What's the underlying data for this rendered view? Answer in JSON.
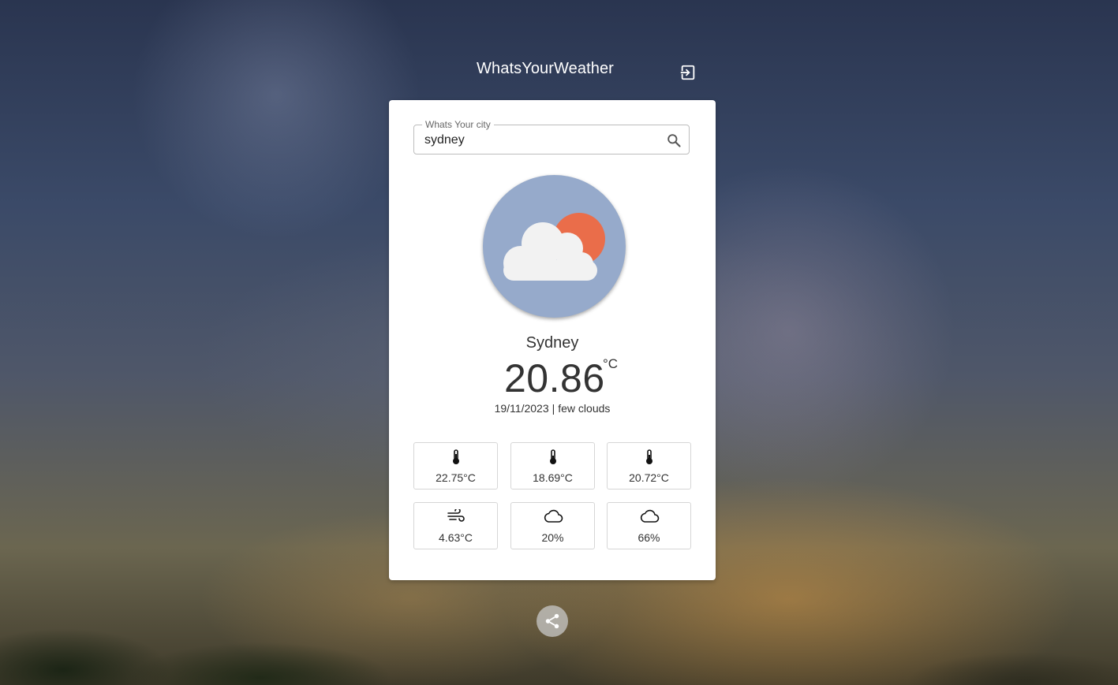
{
  "app": {
    "title": "WhatsYourWeather"
  },
  "search": {
    "label": "Whats Your city",
    "value": "sydney",
    "placeholder": "Whats Your city"
  },
  "weather": {
    "icon": "few-clouds-icon",
    "city": "Sydney",
    "temperature": "20.86",
    "unit": "°C",
    "date": "19/11/2023",
    "separator": "|",
    "description": "few clouds"
  },
  "stats": [
    {
      "icon": "thermometer-icon",
      "value": "22.75°C"
    },
    {
      "icon": "thermometer-icon",
      "value": "18.69°C"
    },
    {
      "icon": "thermometer-icon",
      "value": "20.72°C"
    },
    {
      "icon": "wind-icon",
      "value": "4.63°C"
    },
    {
      "icon": "cloud-icon",
      "value": "20%"
    },
    {
      "icon": "cloud-icon",
      "value": "66%"
    }
  ],
  "colors": {
    "icon_bg": "#96aacb",
    "sun": "#ea6d4a",
    "cloud": "#f2f2f2",
    "card": "#ffffff",
    "text": "#333333"
  },
  "actions": {
    "logout_icon": "logout-icon",
    "share_icon": "share-icon"
  }
}
